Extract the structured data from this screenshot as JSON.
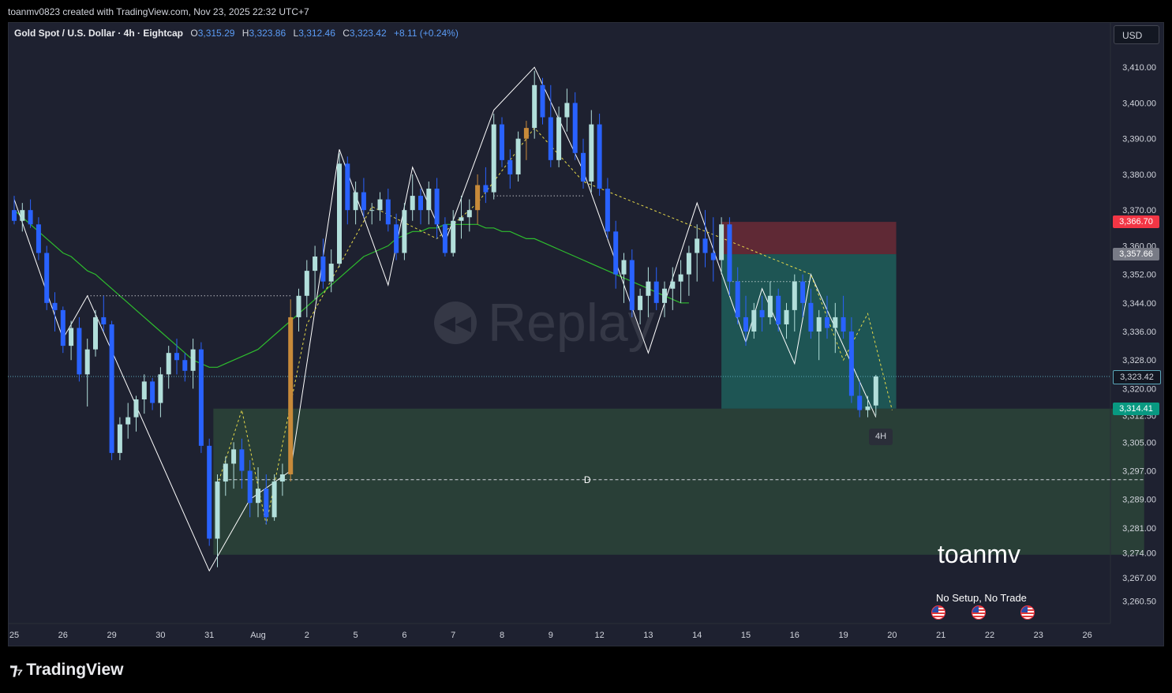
{
  "header": {
    "credit": "toanmv0823 created with TradingView.com, Nov 23, 2025 22:32 UTC+7",
    "symbol": "Gold Spot / U.S. Dollar · 4h · Eightcap",
    "open_label": "O",
    "open": "3,315.29",
    "high_label": "H",
    "high": "3,323.86",
    "low_label": "L",
    "low": "3,312.46",
    "close_label": "C",
    "close": "3,323.42",
    "change": "+8.11 (+0.24%)"
  },
  "currency": "USD",
  "watermark": {
    "icon": "replay-icon",
    "text": "Replay"
  },
  "author_label": "toanmv",
  "note": "No Setup, No Trade",
  "timeframe_tag": "4H",
  "zone_label": "D",
  "footer": {
    "brand": "TradingView",
    "logo_icon": "tradingview-logo-icon"
  },
  "price_tags": [
    {
      "value": 3366.7,
      "label": "3,366.70",
      "bg": "#f23645",
      "fg": "#ffffff"
    },
    {
      "value": 3357.66,
      "label": "3,357.66",
      "bg": "#787b86",
      "fg": "#ffffff"
    },
    {
      "value": 3323.42,
      "label": "3,323.42",
      "bg": "#131722",
      "fg": "#d1d4dc"
    },
    {
      "value": 3314.41,
      "label": "3,314.41",
      "bg": "#089981",
      "fg": "#ffffff"
    }
  ],
  "colors": {
    "up_candle": "#b2dfdb",
    "down_candle": "#2962ff",
    "highlight_candle": "#c88a3a",
    "ema": "#2ebd2e",
    "pattern_line": "#ffffff",
    "retrace_line": "#e6d94a",
    "demand_zone": "#2d4a3a",
    "target_zone": "#1f5e5a",
    "stop_zone": "#6b2a36"
  },
  "chart_data": {
    "type": "candlestick",
    "ylim": [
      3256,
      3418
    ],
    "yticks": [
      {
        "v": 3410,
        "label": "3,410.00"
      },
      {
        "v": 3400,
        "label": "3,400.00"
      },
      {
        "v": 3390,
        "label": "3,390.00"
      },
      {
        "v": 3380,
        "label": "3,380.00"
      },
      {
        "v": 3370,
        "label": "3,370.00"
      },
      {
        "v": 3360,
        "label": "3,360.00"
      },
      {
        "v": 3352,
        "label": "3,352.00"
      },
      {
        "v": 3344,
        "label": "3,344.00"
      },
      {
        "v": 3336,
        "label": "3,336.00"
      },
      {
        "v": 3328,
        "label": "3,328.00"
      },
      {
        "v": 3320,
        "label": "3,320.00"
      },
      {
        "v": 3312.5,
        "label": "3,312.50"
      },
      {
        "v": 3305,
        "label": "3,305.00"
      },
      {
        "v": 3297,
        "label": "3,297.00"
      },
      {
        "v": 3289,
        "label": "3,289.00"
      },
      {
        "v": 3281,
        "label": "3,281.00"
      },
      {
        "v": 3274,
        "label": "3,274.00"
      },
      {
        "v": 3267,
        "label": "3,267.00"
      },
      {
        "v": 3260.5,
        "label": "3,260.50"
      }
    ],
    "xticks": [
      {
        "i": 0,
        "label": "25"
      },
      {
        "i": 6,
        "label": "26"
      },
      {
        "i": 12,
        "label": "29"
      },
      {
        "i": 18,
        "label": "30"
      },
      {
        "i": 24,
        "label": "31"
      },
      {
        "i": 30,
        "label": "Aug"
      },
      {
        "i": 36,
        "label": "2"
      },
      {
        "i": 42,
        "label": "5"
      },
      {
        "i": 48,
        "label": "6"
      },
      {
        "i": 54,
        "label": "7"
      },
      {
        "i": 60,
        "label": "8"
      },
      {
        "i": 66,
        "label": "9"
      },
      {
        "i": 72,
        "label": "12"
      },
      {
        "i": 78,
        "label": "13"
      },
      {
        "i": 84,
        "label": "14"
      },
      {
        "i": 90,
        "label": "15"
      },
      {
        "i": 96,
        "label": "16"
      },
      {
        "i": 102,
        "label": "19"
      },
      {
        "i": 108,
        "label": "20"
      },
      {
        "i": 114,
        "label": "21"
      },
      {
        "i": 120,
        "label": "22"
      },
      {
        "i": 126,
        "label": "23"
      },
      {
        "i": 132,
        "label": "26"
      }
    ],
    "series_start_index": 0,
    "candles": [
      [
        3370,
        3374,
        3366,
        3367
      ],
      [
        3367,
        3372,
        3364,
        3370
      ],
      [
        3370,
        3373,
        3365,
        3366
      ],
      [
        3366,
        3368,
        3356,
        3358
      ],
      [
        3358,
        3360,
        3342,
        3344
      ],
      [
        3344,
        3347,
        3336,
        3342
      ],
      [
        3342,
        3343,
        3330,
        3332
      ],
      [
        3332,
        3339,
        3328,
        3337
      ],
      [
        3337,
        3340,
        3322,
        3324
      ],
      [
        3324,
        3334,
        3315,
        3331
      ],
      [
        3331,
        3342,
        3329,
        3340
      ],
      [
        3340,
        3346,
        3336,
        3338
      ],
      [
        3338,
        3339,
        3300,
        3302
      ],
      [
        3302,
        3312,
        3300,
        3310
      ],
      [
        3310,
        3316,
        3306,
        3312
      ],
      [
        3312,
        3318,
        3308,
        3317
      ],
      [
        3317,
        3324,
        3313,
        3322
      ],
      [
        3322,
        3323,
        3314,
        3316
      ],
      [
        3316,
        3326,
        3312,
        3324
      ],
      [
        3324,
        3332,
        3320,
        3330
      ],
      [
        3330,
        3334,
        3324,
        3328
      ],
      [
        3328,
        3330,
        3322,
        3325
      ],
      [
        3325,
        3334,
        3320,
        3331
      ],
      [
        3331,
        3333,
        3302,
        3304
      ],
      [
        3304,
        3306,
        3276,
        3278
      ],
      [
        3278,
        3296,
        3270,
        3294
      ],
      [
        3294,
        3301,
        3290,
        3299
      ],
      [
        3299,
        3305,
        3292,
        3303
      ],
      [
        3303,
        3306,
        3292,
        3297
      ],
      [
        3297,
        3300,
        3284,
        3288
      ],
      [
        3288,
        3298,
        3284,
        3292
      ],
      [
        3292,
        3296,
        3282,
        3284
      ],
      [
        3284,
        3296,
        3283,
        3294
      ],
      [
        3294,
        3299,
        3290,
        3296
      ],
      [
        3296,
        3345,
        3294,
        3340
      ],
      [
        3340,
        3348,
        3336,
        3346
      ],
      [
        3346,
        3356,
        3340,
        3353
      ],
      [
        3353,
        3360,
        3345,
        3357
      ],
      [
        3357,
        3362,
        3348,
        3350
      ],
      [
        3350,
        3359,
        3347,
        3355
      ],
      [
        3355,
        3386,
        3354,
        3383
      ],
      [
        3383,
        3385,
        3366,
        3370
      ],
      [
        3370,
        3378,
        3366,
        3375
      ],
      [
        3375,
        3379,
        3368,
        3370
      ],
      [
        3370,
        3372,
        3366,
        3370
      ],
      [
        3370,
        3375,
        3367,
        3373
      ],
      [
        3373,
        3376,
        3364,
        3366
      ],
      [
        3366,
        3369,
        3356,
        3358
      ],
      [
        3358,
        3372,
        3356,
        3370
      ],
      [
        3370,
        3380,
        3367,
        3374
      ],
      [
        3374,
        3376,
        3366,
        3370
      ],
      [
        3370,
        3378,
        3366,
        3376
      ],
      [
        3376,
        3379,
        3362,
        3366
      ],
      [
        3366,
        3368,
        3357,
        3358
      ],
      [
        3358,
        3370,
        3357,
        3367
      ],
      [
        3367,
        3374,
        3362,
        3368
      ],
      [
        3368,
        3373,
        3364,
        3370
      ],
      [
        3370,
        3380,
        3366,
        3377
      ],
      [
        3377,
        3382,
        3372,
        3375
      ],
      [
        3375,
        3397,
        3373,
        3394
      ],
      [
        3394,
        3396,
        3382,
        3384
      ],
      [
        3384,
        3387,
        3376,
        3380
      ],
      [
        3380,
        3392,
        3378,
        3390
      ],
      [
        3390,
        3395,
        3384,
        3393
      ],
      [
        3393,
        3409,
        3390,
        3405
      ],
      [
        3405,
        3407,
        3394,
        3396
      ],
      [
        3396,
        3405,
        3382,
        3384
      ],
      [
        3384,
        3399,
        3382,
        3396
      ],
      [
        3396,
        3404,
        3392,
        3400
      ],
      [
        3400,
        3403,
        3384,
        3386
      ],
      [
        3386,
        3390,
        3376,
        3378
      ],
      [
        3378,
        3398,
        3375,
        3394
      ],
      [
        3394,
        3397,
        3374,
        3376
      ],
      [
        3376,
        3379,
        3362,
        3364
      ],
      [
        3364,
        3367,
        3348,
        3352
      ],
      [
        3352,
        3358,
        3344,
        3356
      ],
      [
        3356,
        3359,
        3340,
        3342
      ],
      [
        3342,
        3348,
        3338,
        3346
      ],
      [
        3346,
        3354,
        3340,
        3350
      ],
      [
        3350,
        3354,
        3342,
        3344
      ],
      [
        3344,
        3350,
        3340,
        3348
      ],
      [
        3348,
        3354,
        3342,
        3350
      ],
      [
        3350,
        3356,
        3344,
        3352
      ],
      [
        3352,
        3360,
        3346,
        3358
      ],
      [
        3358,
        3366,
        3350,
        3362
      ],
      [
        3362,
        3370,
        3354,
        3358
      ],
      [
        3358,
        3368,
        3350,
        3356
      ],
      [
        3356,
        3368,
        3352,
        3366
      ],
      [
        3366,
        3368,
        3346,
        3350
      ],
      [
        3350,
        3354,
        3338,
        3340
      ],
      [
        3340,
        3346,
        3332,
        3336
      ],
      [
        3336,
        3344,
        3334,
        3342
      ],
      [
        3342,
        3346,
        3336,
        3340
      ],
      [
        3340,
        3350,
        3338,
        3346
      ],
      [
        3346,
        3348,
        3336,
        3338
      ],
      [
        3338,
        3344,
        3334,
        3342
      ],
      [
        3342,
        3352,
        3336,
        3350
      ],
      [
        3350,
        3352,
        3340,
        3344
      ],
      [
        3344,
        3348,
        3334,
        3336
      ],
      [
        3336,
        3342,
        3328,
        3340
      ],
      [
        3340,
        3346,
        3334,
        3337
      ],
      [
        3337,
        3344,
        3330,
        3340
      ],
      [
        3340,
        3346,
        3334,
        3336
      ],
      [
        3336,
        3340,
        3316,
        3318
      ],
      [
        3318,
        3322,
        3312,
        3314
      ],
      [
        3314,
        3318,
        3312,
        3315
      ],
      [
        3315.29,
        3323.86,
        3312.46,
        3323.42
      ]
    ],
    "ema_values": [
      3370,
      3368,
      3366,
      3364,
      3362,
      3360,
      3358,
      3357,
      3355,
      3353,
      3352,
      3350,
      3348,
      3346,
      3344,
      3342,
      3340,
      3338,
      3336,
      3334,
      3332,
      3330,
      3328,
      3327,
      3326,
      3326,
      3327,
      3328,
      3329,
      3330,
      3331,
      3333,
      3335,
      3337,
      3339,
      3341,
      3343,
      3345,
      3347,
      3349,
      3351,
      3353,
      3355,
      3357,
      3358,
      3359,
      3360,
      3362,
      3363,
      3364,
      3364,
      3365,
      3365,
      3366,
      3366,
      3366,
      3366,
      3366,
      3365,
      3365,
      3364,
      3364,
      3363,
      3362,
      3362,
      3361,
      3360,
      3359,
      3358,
      3357,
      3356,
      3355,
      3354,
      3353,
      3352,
      3351,
      3350,
      3349,
      3348,
      3347,
      3346,
      3345,
      3344,
      3344
    ],
    "ema_start_index": 0,
    "levels": [
      {
        "price": 3323.42,
        "style": "dotted",
        "color": "#5aa7b8",
        "name": "last-price-line"
      },
      {
        "price": 3294.5,
        "style": "dashed",
        "color": "#d1d4dc",
        "name": "zone-d-line"
      }
    ],
    "zones": [
      {
        "name": "demand-zone",
        "i0": 24.5,
        "i1": 139,
        "top": 3314.41,
        "bottom": 3273.5,
        "color": "#2d4a3a"
      },
      {
        "name": "target-zone",
        "i0": 87,
        "i1": 108.5,
        "top": 3357.66,
        "bottom": 3314.41,
        "color": "#1f5e5a"
      },
      {
        "name": "stop-zone",
        "i0": 87,
        "i1": 108.5,
        "top": 3366.7,
        "bottom": 3357.66,
        "color": "#6b2a36"
      }
    ],
    "patterns": [
      {
        "color": "#ffffff",
        "dash": "",
        "points": [
          [
            0,
            3373
          ],
          [
            6,
            3334
          ],
          [
            9,
            3346
          ],
          [
            24,
            3269
          ],
          [
            29,
            3289
          ],
          [
            34,
            3297
          ],
          [
            40,
            3387
          ],
          [
            46,
            3349
          ],
          [
            49,
            3382
          ],
          [
            53,
            3361
          ],
          [
            59,
            3398
          ],
          [
            64,
            3410
          ],
          [
            70,
            3381
          ],
          [
            78,
            3330
          ],
          [
            84,
            3372
          ],
          [
            90,
            3333
          ],
          [
            92,
            3348
          ],
          [
            96,
            3327
          ],
          [
            98,
            3352
          ],
          [
            106,
            3312
          ]
        ]
      },
      {
        "color": "#e6d94a",
        "dash": "3,3",
        "points": [
          [
            25,
            3293
          ],
          [
            28,
            3314
          ],
          [
            31,
            3282
          ],
          [
            36,
            3338
          ],
          [
            44,
            3371
          ],
          [
            52,
            3362
          ],
          [
            57,
            3372
          ],
          [
            64,
            3393
          ],
          [
            70,
            3378
          ],
          [
            98,
            3352
          ],
          [
            102,
            3328
          ],
          [
            105,
            3341
          ],
          [
            108,
            3314
          ]
        ]
      },
      {
        "color": "#ffffff",
        "dash": "1,3",
        "points": [
          [
            9,
            3346
          ],
          [
            34,
            3346
          ]
        ]
      },
      {
        "color": "#ffffff",
        "dash": "1,3",
        "points": [
          [
            59,
            3374
          ],
          [
            70,
            3374
          ]
        ]
      },
      {
        "color": "#ffffff",
        "dash": "1,3",
        "points": [
          [
            88,
            3350
          ],
          [
            98,
            3350
          ]
        ]
      }
    ],
    "highlight_candles": [
      34,
      57,
      63
    ]
  }
}
